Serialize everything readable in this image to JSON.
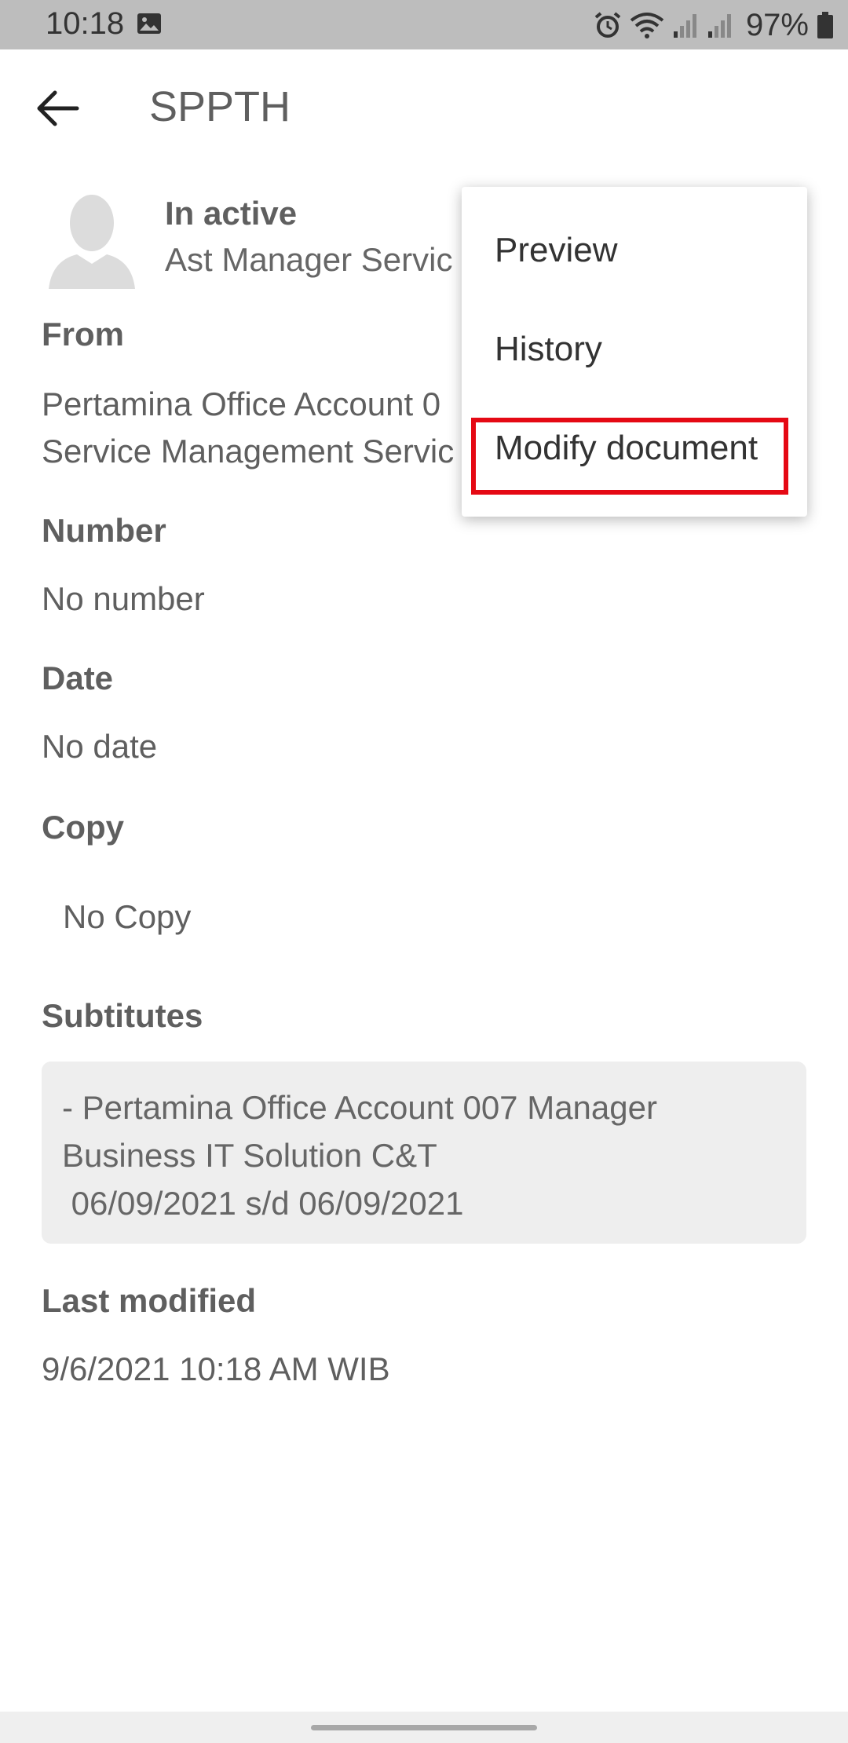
{
  "status_bar": {
    "time": "10:18",
    "battery": "97%",
    "icons": [
      "gallery-icon",
      "alarm-icon",
      "wifi-icon",
      "signal-icon",
      "signal-icon",
      "battery-icon"
    ]
  },
  "app_bar": {
    "title": "SPPTH"
  },
  "profile": {
    "status": "In active",
    "role": "Ast Manager Servic"
  },
  "fields": {
    "from_label": "From",
    "from_line1": "Pertamina Office Account 0",
    "from_line2": "Service Management Servic",
    "number_label": "Number",
    "number_value": "No number",
    "date_label": "Date",
    "date_value": "No date",
    "copy_label": "Copy",
    "copy_value": "No Copy",
    "substitutes_label": "Subtitutes",
    "substitutes_value": "- Pertamina Office Account 007 Manager\nBusiness IT Solution C&T\n 06/09/2021 s/d 06/09/2021",
    "last_modified_label": "Last modified",
    "last_modified_value": "9/6/2021 10:18 AM WIB"
  },
  "menu": {
    "items": [
      "Preview",
      "History",
      "Modify document"
    ],
    "highlight_color": "#e50914"
  }
}
